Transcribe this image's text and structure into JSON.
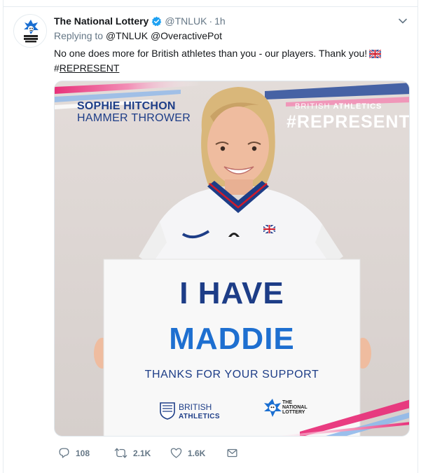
{
  "tweet": {
    "display_name": "The National Lottery",
    "handle": "@TNLUK",
    "separator": "·",
    "time": "1h",
    "verified": true,
    "replying_to_label": "Replying to",
    "replying_to": [
      "@TNLUK",
      "@OveractivePot"
    ],
    "text": "No one does more for British athletes than you - our players. Thank you!",
    "flag_icon": "uk-flag-icon",
    "hashtag_symbol": "#",
    "hashtag_word": "REPRESENT"
  },
  "media": {
    "athlete_name": "SOPHIE HITCHON",
    "athlete_role": "HAMMER THROWER",
    "brand_small_prefix": "BRITISH ",
    "brand_small_bold": "ATHLETICS",
    "brand_hashtag": "#REPRESENT",
    "board_line1": "I HAVE",
    "board_line2": "MADDIE",
    "board_line3": "THANKS FOR YOUR SUPPORT",
    "board_logo1_line1": "BRITISH",
    "board_logo1_line2": "ATHLETICS",
    "board_logo2_line1": "THE",
    "board_logo2_line2": "NATIONAL",
    "board_logo2_line3": "LOTTERY"
  },
  "actions": {
    "reply_count": "108",
    "retweet_count": "2.1K",
    "like_count": "1.6K"
  },
  "colors": {
    "text": "#14171a",
    "muted": "#657786",
    "verified": "#1da1f2",
    "navy": "#1d3d87",
    "blue": "#1e6fd0"
  }
}
